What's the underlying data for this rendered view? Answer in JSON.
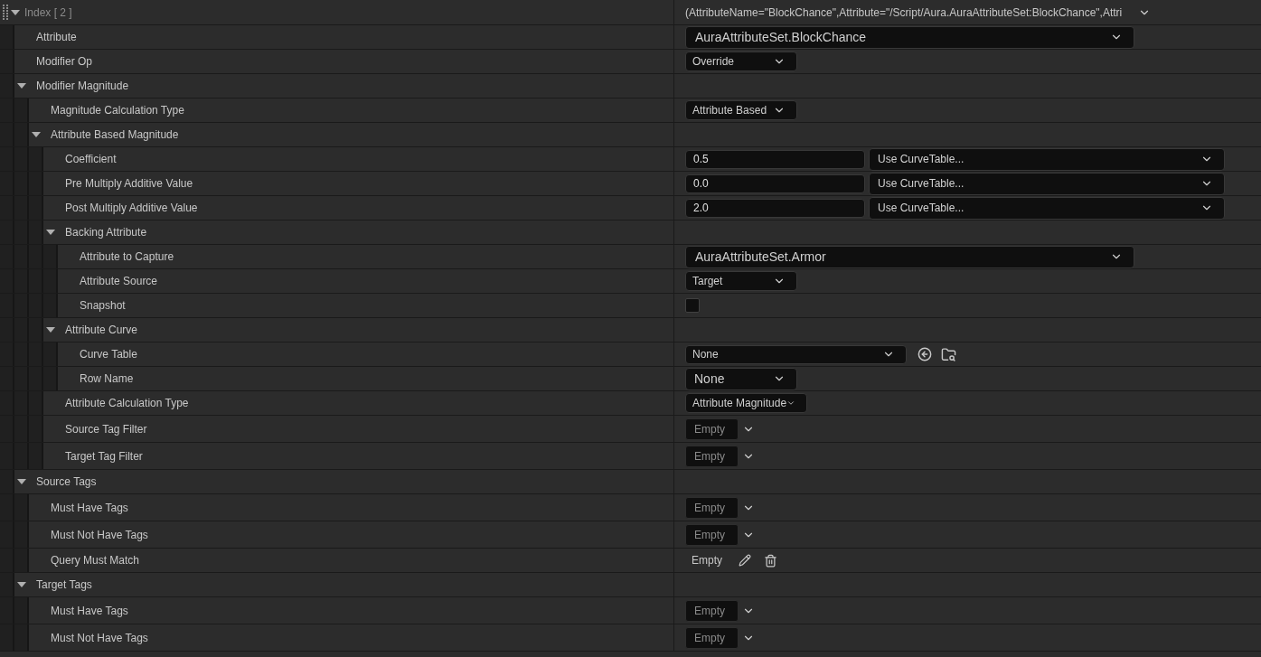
{
  "header": {
    "label": "Index [ 2 ]",
    "expanded": true,
    "summary": "(AttributeName=\"BlockChance\",Attribute=\"/Script/Aura.AuraAttributeSet:BlockChance\",Attri"
  },
  "properties": [
    {
      "label": "Attribute",
      "kind": "attribute",
      "value": "AuraAttributeSet.BlockChance"
    },
    {
      "label": "Modifier Op",
      "kind": "enum",
      "value": "Override"
    },
    {
      "label": "Modifier Magnitude",
      "expanded": true,
      "children": [
        {
          "label": "Magnitude Calculation Type",
          "kind": "enum",
          "value": "Attribute Based"
        },
        {
          "label": "Attribute Based Magnitude",
          "expanded": true,
          "children": [
            {
              "label": "Coefficient",
              "kind": "float_curve",
              "value": "0.5",
              "curve": "Use CurveTable..."
            },
            {
              "label": "Pre Multiply Additive Value",
              "kind": "float_curve",
              "value": "0.0",
              "curve": "Use CurveTable..."
            },
            {
              "label": "Post Multiply Additive Value",
              "kind": "float_curve",
              "value": "2.0",
              "curve": "Use CurveTable..."
            },
            {
              "label": "Backing Attribute",
              "expanded": true,
              "children": [
                {
                  "label": "Attribute to Capture",
                  "kind": "attribute",
                  "value": "AuraAttributeSet.Armor"
                },
                {
                  "label": "Attribute Source",
                  "kind": "enum",
                  "value": "Target"
                },
                {
                  "label": "Snapshot",
                  "kind": "checkbox",
                  "checked": false
                }
              ]
            },
            {
              "label": "Attribute Curve",
              "expanded": true,
              "children": [
                {
                  "label": "Curve Table",
                  "kind": "asset",
                  "value": "None"
                },
                {
                  "label": "Row Name",
                  "kind": "name",
                  "value": "None"
                }
              ]
            },
            {
              "label": "Attribute Calculation Type",
              "kind": "enum",
              "value": "Attribute Magnitude"
            },
            {
              "label": "Source Tag Filter",
              "kind": "tags",
              "value": "Empty"
            },
            {
              "label": "Target Tag Filter",
              "kind": "tags",
              "value": "Empty"
            }
          ]
        }
      ]
    },
    {
      "label": "Source Tags",
      "expanded": true,
      "children": [
        {
          "label": "Must Have Tags",
          "kind": "tags",
          "value": "Empty"
        },
        {
          "label": "Must Not Have Tags",
          "kind": "tags",
          "value": "Empty"
        },
        {
          "label": "Query Must Match",
          "kind": "query",
          "value": "Empty"
        }
      ]
    },
    {
      "label": "Target Tags",
      "expanded": true,
      "children": [
        {
          "label": "Must Have Tags",
          "kind": "tags",
          "value": "Empty"
        },
        {
          "label": "Must Not Have Tags",
          "kind": "tags",
          "value": "Empty"
        }
      ]
    }
  ]
}
